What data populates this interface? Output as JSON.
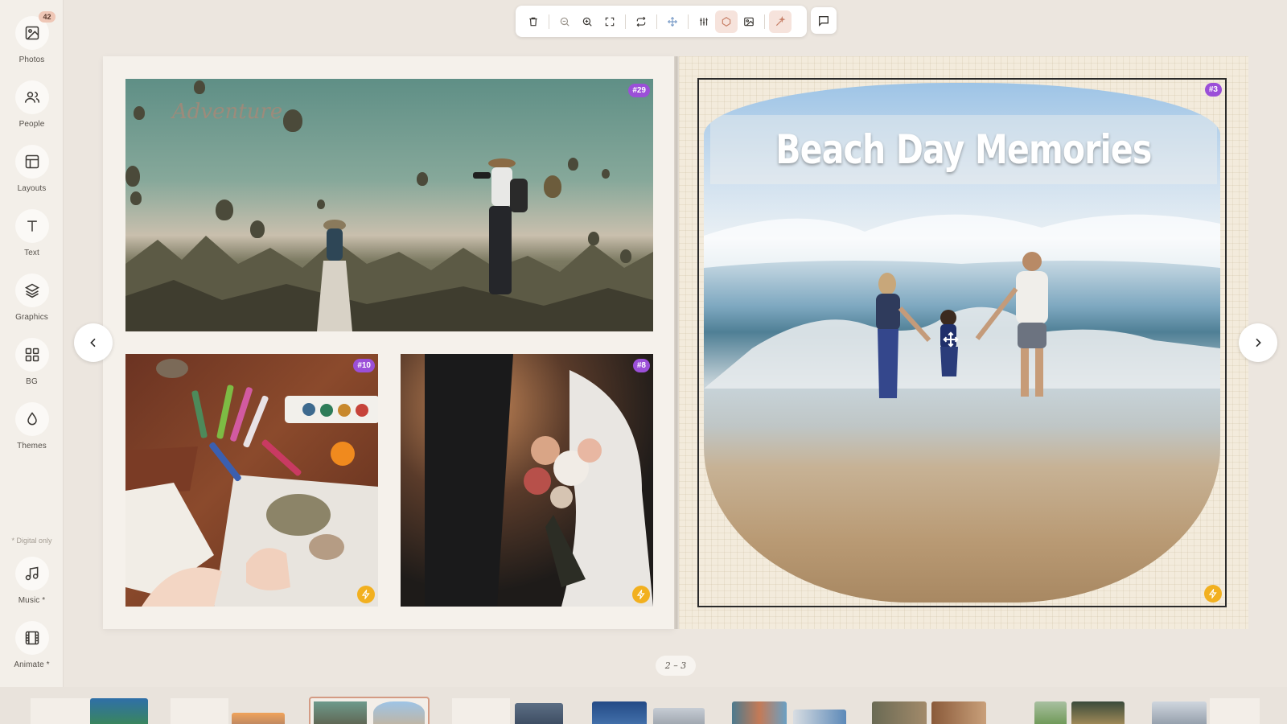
{
  "sidebar": {
    "photos_badge": "42",
    "items": [
      {
        "label": "Photos",
        "icon": "image-icon"
      },
      {
        "label": "People",
        "icon": "people-icon"
      },
      {
        "label": "Layouts",
        "icon": "layout-icon"
      },
      {
        "label": "Text",
        "icon": "text-icon"
      },
      {
        "label": "Graphics",
        "icon": "layers-icon"
      },
      {
        "label": "BG",
        "icon": "grid-icon"
      },
      {
        "label": "Themes",
        "icon": "drop-icon"
      }
    ],
    "digital_note": "* Digital only",
    "digital_items": [
      {
        "label": "Music *",
        "icon": "music-icon"
      },
      {
        "label": "Animate *",
        "icon": "film-icon"
      }
    ]
  },
  "toolbar": {
    "tools": [
      "delete-icon",
      "zoom-out-icon",
      "zoom-in-icon",
      "fit-icon",
      "replace-icon",
      "move-icon",
      "adjust-icon",
      "shape-icon",
      "image-icon",
      "magic-icon"
    ],
    "comment_icon": "comment-icon"
  },
  "left_page": {
    "photos": [
      {
        "id": "balloons",
        "tag": "#29",
        "overlay_text": "Adventure"
      },
      {
        "id": "crafts",
        "tag": "#10"
      },
      {
        "id": "wedding",
        "tag": "#8"
      }
    ]
  },
  "right_page": {
    "photo_tag": "#3",
    "title": "Beach Day Memories"
  },
  "page_indicator": "2 – 3",
  "colors": {
    "accent": "#9b4fd8",
    "bolt": "#f2b01f",
    "selected_border": "#d49b84"
  }
}
